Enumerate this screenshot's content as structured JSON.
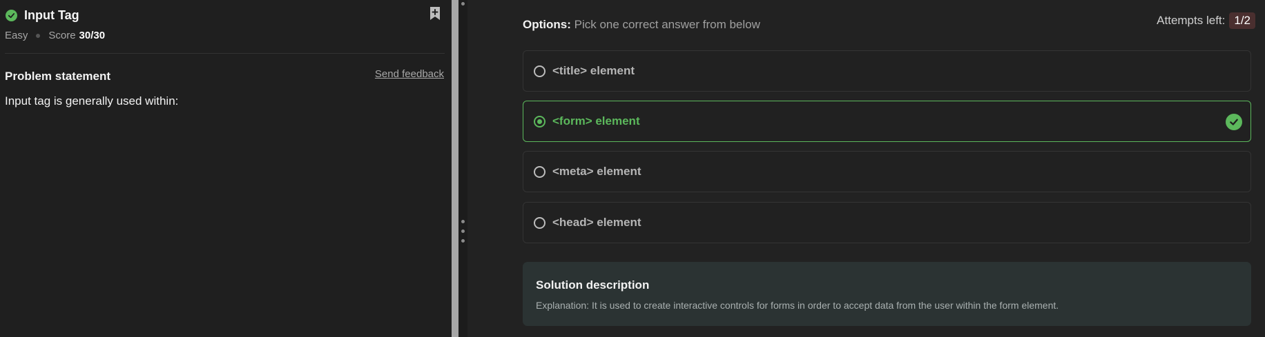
{
  "problem": {
    "title": "Input Tag",
    "difficulty": "Easy",
    "score_label": "Score",
    "score_value": "30/30",
    "statement_heading": "Problem statement",
    "feedback_link": "Send feedback",
    "question": "Input tag is generally used within:"
  },
  "options": {
    "heading_label": "Options:",
    "heading_text": "Pick one correct answer from below",
    "attempts_label": "Attempts left:",
    "attempts_value": "1/2",
    "items": [
      {
        "label": "<title> element",
        "selected": false,
        "correct": false
      },
      {
        "label": "<form> element",
        "selected": true,
        "correct": true
      },
      {
        "label": "<meta> element",
        "selected": false,
        "correct": false
      },
      {
        "label": "<head> element",
        "selected": false,
        "correct": false
      }
    ]
  },
  "solution": {
    "title": "Solution description",
    "text": "Explanation: It is used to create interactive controls for forms in order to accept data from the user within the form element."
  },
  "colors": {
    "success": "#5cb85c",
    "background": "#202020",
    "attempts_badge": "#4a2f2f",
    "solution_bg": "#2b3333"
  },
  "icons": {
    "solved": "check-circle-icon",
    "bookmark": "bookmark-plus-icon",
    "correct": "check-circle-icon",
    "splitter": "drag-handle-icon"
  }
}
